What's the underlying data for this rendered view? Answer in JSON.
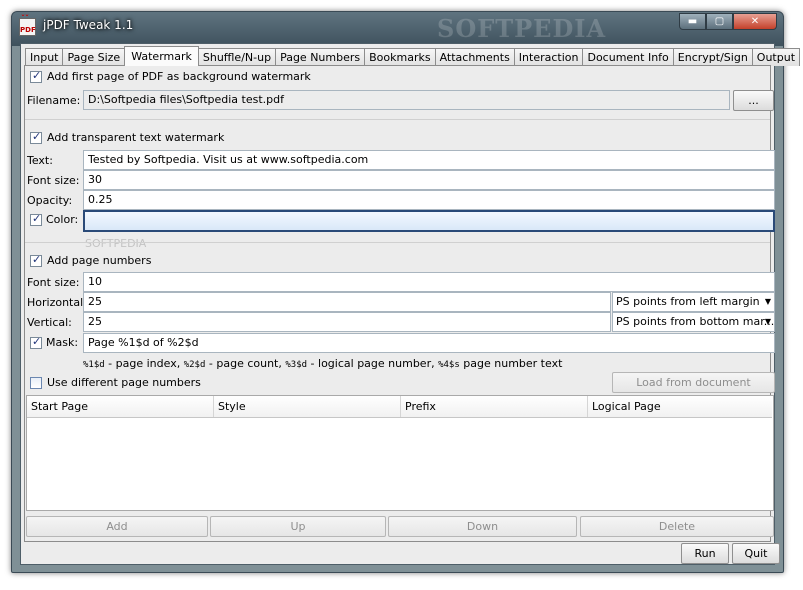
{
  "window": {
    "title": "jPDF Tweak 1.1",
    "watermark_text": "SOFTPEDIA",
    "controls": {
      "minimize": "▬",
      "maximize": "▢",
      "close": "✕"
    }
  },
  "tabs": [
    {
      "label": "Input"
    },
    {
      "label": "Page Size"
    },
    {
      "label": "Watermark",
      "active": true
    },
    {
      "label": "Shuffle/N-up"
    },
    {
      "label": "Page Numbers"
    },
    {
      "label": "Bookmarks"
    },
    {
      "label": "Attachments"
    },
    {
      "label": "Interaction"
    },
    {
      "label": "Document Info"
    },
    {
      "label": "Encrypt/Sign"
    },
    {
      "label": "Output"
    }
  ],
  "pdf_watermark": {
    "checkbox_label": "Add first page of PDF as background watermark",
    "checked": true,
    "filename_label": "Filename:",
    "filename_value": "D:\\Softpedia files\\Softpedia test.pdf",
    "browse_label": "..."
  },
  "text_watermark": {
    "checkbox_label": "Add transparent text watermark",
    "checked": true,
    "text_label": "Text:",
    "text_value": "Tested by Softpedia. Visit us at www.softpedia.com",
    "font_size_label": "Font size:",
    "font_size_value": "30",
    "opacity_label": "Opacity:",
    "opacity_value": "0.25",
    "color_label": "Color:",
    "color_checked": true,
    "color_value": "#d6e6f7"
  },
  "page_numbers": {
    "checkbox_label": "Add page numbers",
    "checked": true,
    "font_size_label": "Font size:",
    "font_size_value": "10",
    "horizontal_label": "Horizontal:",
    "horizontal_value": "25",
    "horizontal_unit": "PS points from left margin",
    "vertical_label": "Vertical:",
    "vertical_value": "25",
    "vertical_unit": "PS points from bottom mar...",
    "mask_label": "Mask:",
    "mask_checked": true,
    "mask_value": "Page %1$d of %2$d",
    "hint_tokens": [
      "%1$d",
      "%2$d",
      "%3$d",
      "%4$s"
    ],
    "hint_texts": [
      " - page index, ",
      " - page count, ",
      " - logical page number, ",
      " page number text"
    ],
    "different_label": "Use different page numbers",
    "different_checked": false,
    "load_button": "Load from document"
  },
  "table": {
    "columns": [
      "Start Page",
      "Style",
      "Prefix",
      "Logical Page"
    ]
  },
  "row_buttons": {
    "add": "Add",
    "up": "Up",
    "down": "Down",
    "delete": "Delete"
  },
  "footer": {
    "run": "Run",
    "quit": "Quit"
  }
}
